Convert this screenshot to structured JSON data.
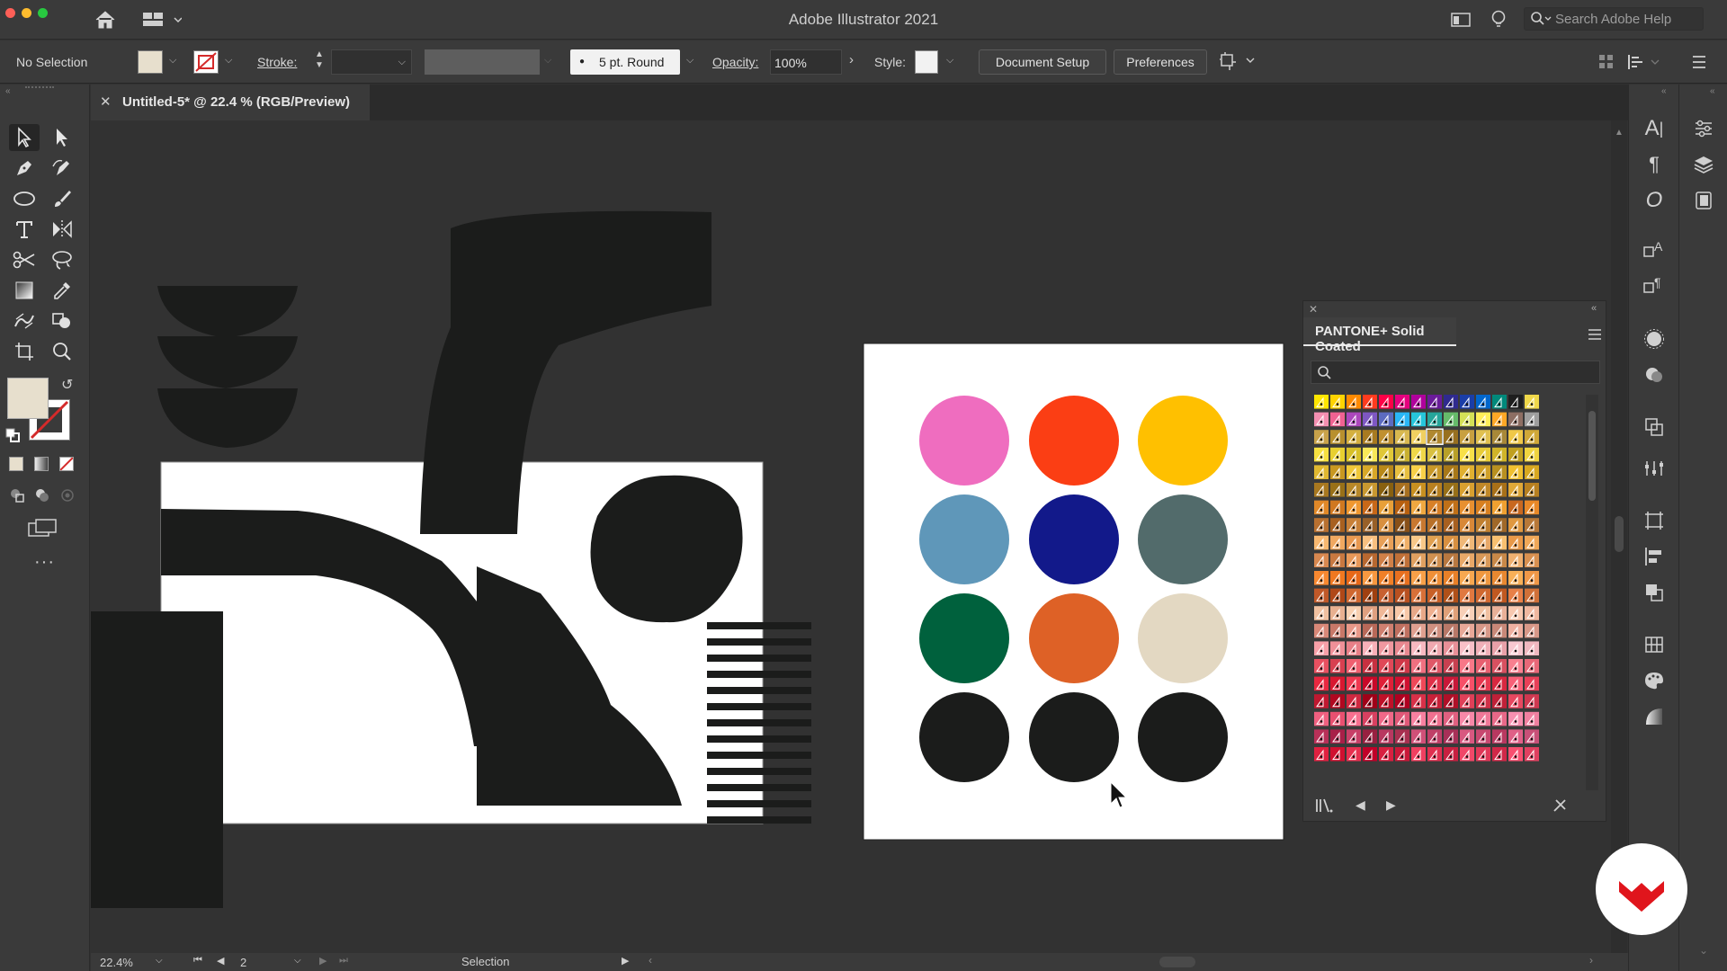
{
  "app": {
    "title": "Adobe Illustrator 2021"
  },
  "titlebar": {
    "search_placeholder": "Search Adobe Help"
  },
  "control": {
    "selection_label": "No Selection",
    "stroke_label": "Stroke:",
    "brush_label": "5 pt. Round",
    "opacity_label": "Opacity:",
    "opacity_value": "100%",
    "style_label": "Style:",
    "document_setup": "Document Setup",
    "preferences": "Preferences"
  },
  "document": {
    "tab_title": "Untitled-5* @ 22.4 % (RGB/Preview)"
  },
  "swatches": {
    "panel_title": "PANTONE+ Solid Coated",
    "search_placeholder": ""
  },
  "status": {
    "zoom": "22.4%",
    "artboard": "2",
    "tool": "Selection"
  },
  "colors": {
    "fill": "#e7dfcd",
    "accent_logo": "#e0151c",
    "palette": [
      "#ef6dbf",
      "#fb3e14",
      "#ffc000",
      "#5f97b9",
      "#12198a",
      "#526b6b",
      "#00613d",
      "#de6126",
      "#e3d8c2",
      "#1b1c1b",
      "#1b1c1b",
      "#1b1c1b"
    ]
  },
  "icons": {
    "home": "home-icon",
    "workspace": "workspace-switcher-icon",
    "lightbulb": "lightbulb-icon",
    "search": "search-icon"
  }
}
